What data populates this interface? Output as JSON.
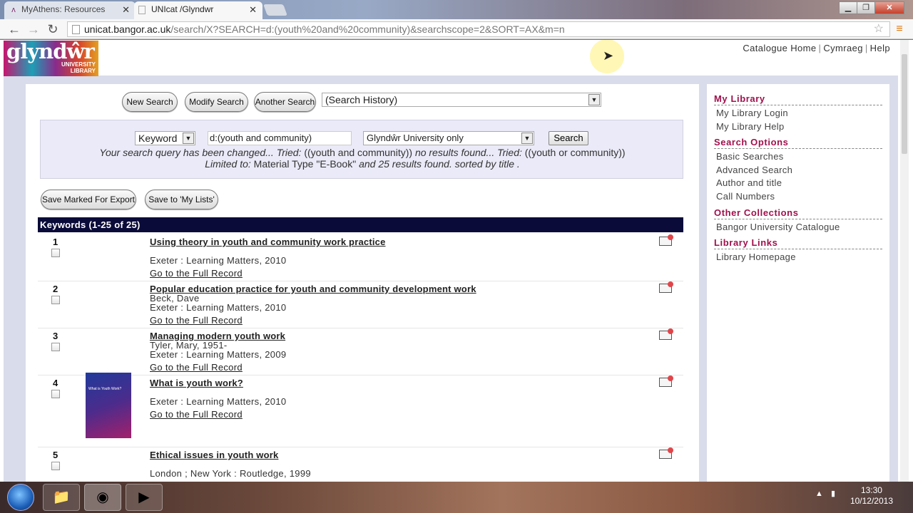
{
  "browser": {
    "tabs": [
      {
        "label": "MyAthens: Resources",
        "active": false
      },
      {
        "label": "UNIcat /Glyndwr",
        "active": true
      }
    ],
    "url_host": "unicat.bangor.ac.uk",
    "url_rest": "/search/X?SEARCH=d:(youth%20and%20community)&searchscope=2&SORT=AX&m=n"
  },
  "header": {
    "logo_main": "glyndŵr",
    "logo_sub1": "UNIVERSITY",
    "logo_sub2": "LIBRARY",
    "links": [
      "Catalogue Home",
      "Cymraeg",
      "Help"
    ]
  },
  "toolbar": {
    "new_search": "New Search",
    "modify_search": "Modify Search",
    "another_search": "Another Search",
    "history": "(Search History)"
  },
  "search": {
    "field_type": "Keyword",
    "query": "d:(youth and community)",
    "scope": "Glyndŵr University only",
    "button": "Search",
    "note_line1_a": "Your search query has been changed... Tried:",
    "note_line1_b": "((youth and community))",
    "note_line1_c": "no results found... Tried:",
    "note_line1_d": "((youth or community))",
    "note_line2_a": "Limited to:",
    "note_line2_b": "Material Type \"E-Book\"",
    "note_line2_c": "and 25 results found. sorted by title ."
  },
  "actions": {
    "save_export": "Save Marked For Export",
    "save_lists": "Save to 'My Lists'"
  },
  "results": {
    "header": "Keywords (1-25 of 25)",
    "full_record_label": "Go to the Full Record",
    "items": [
      {
        "num": "1",
        "title": "Using theory in youth and community work practice",
        "author": "",
        "publisher": "Exeter : Learning Matters, 2010"
      },
      {
        "num": "2",
        "title": "Popular education practice for youth and community development work",
        "author": "Beck, Dave",
        "publisher": "Exeter : Learning Matters, 2010"
      },
      {
        "num": "3",
        "title": "Managing modern youth work",
        "author": "Tyler, Mary, 1951-",
        "publisher": "Exeter : Learning Matters, 2009"
      },
      {
        "num": "4",
        "title": "What is youth work?",
        "author": "",
        "publisher": "Exeter : Learning Matters, 2010",
        "cover_text": "What is Youth Work?"
      },
      {
        "num": "5",
        "title": "Ethical issues in youth work",
        "author": "",
        "publisher": "London ; New York : Routledge, 1999"
      }
    ]
  },
  "sidebar": {
    "sections": [
      {
        "heading": "My Library",
        "links": [
          "My Library Login",
          "My Library Help"
        ]
      },
      {
        "heading": "Search Options",
        "links": [
          "Basic Searches",
          "Advanced Search",
          "Author and title",
          "Call Numbers"
        ]
      },
      {
        "heading": "Other Collections",
        "links": [
          "Bangor University Catalogue"
        ]
      },
      {
        "heading": "Library Links",
        "links": [
          "Library Homepage"
        ]
      }
    ]
  },
  "taskbar": {
    "time": "13:30",
    "date": "10/12/2013"
  }
}
